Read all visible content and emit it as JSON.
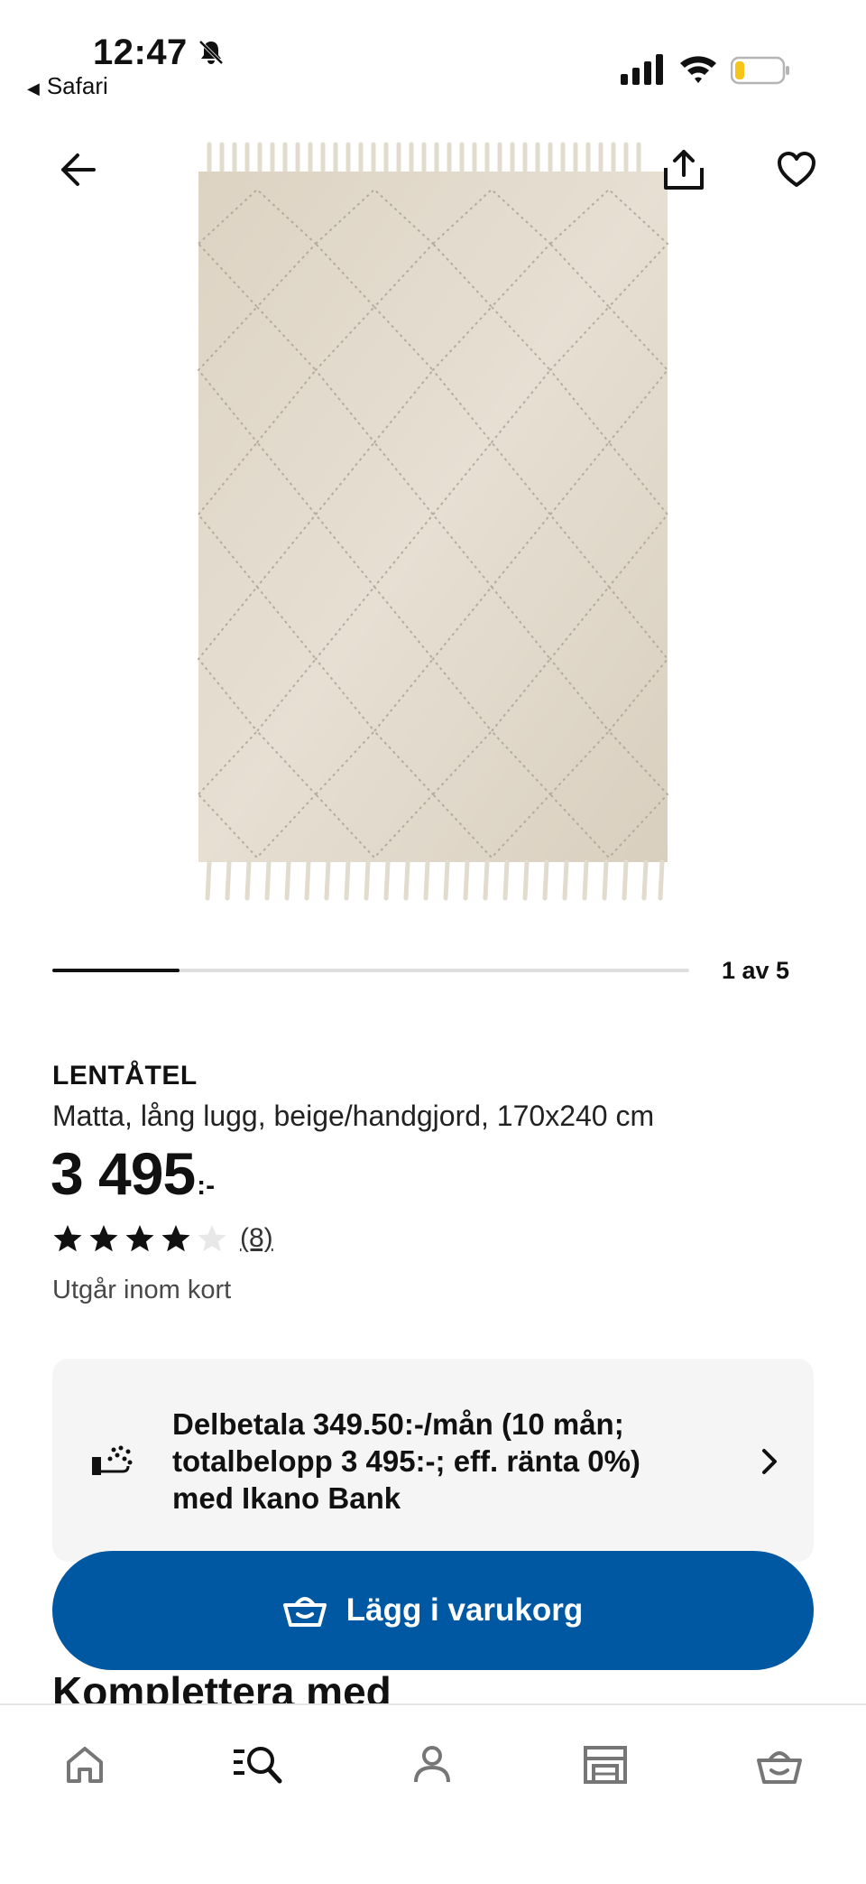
{
  "status_bar": {
    "time": "12:47",
    "back_app": "Safari",
    "icons": [
      "bell-slash-icon",
      "signal-icon",
      "wifi-icon",
      "battery-icon"
    ],
    "battery_level": 0.2,
    "battery_color": "#f5c518"
  },
  "header": {
    "icons": [
      "back-arrow-icon",
      "share-icon",
      "heart-icon"
    ]
  },
  "product": {
    "image_alt": "LENTÅTEL rug image",
    "name": "LENTÅTEL",
    "description": "Matta, lång lugg, beige/handgjord, 170x240 cm",
    "price": "3 495",
    "price_suffix": ":-",
    "rating": 4,
    "rating_max": 5,
    "review_count": "(8)",
    "availability": "Utgår inom kort"
  },
  "carousel": {
    "page_label": "1 av 5",
    "current": 1,
    "total": 5
  },
  "financing": {
    "text": "Delbetala 349.50:-/mån (10 mån; totalbelopp 3 495:-; eff. ränta 0%) med Ikano Bank",
    "icon": "installment-icon"
  },
  "cta": {
    "label": "Lägg i varukorg",
    "color": "#0058a3"
  },
  "section": {
    "heading": "Komplettera med"
  },
  "bottom_nav": {
    "items": [
      "home-icon",
      "search-icon",
      "profile-icon",
      "store-icon",
      "cart-icon"
    ],
    "active": "search-icon"
  }
}
